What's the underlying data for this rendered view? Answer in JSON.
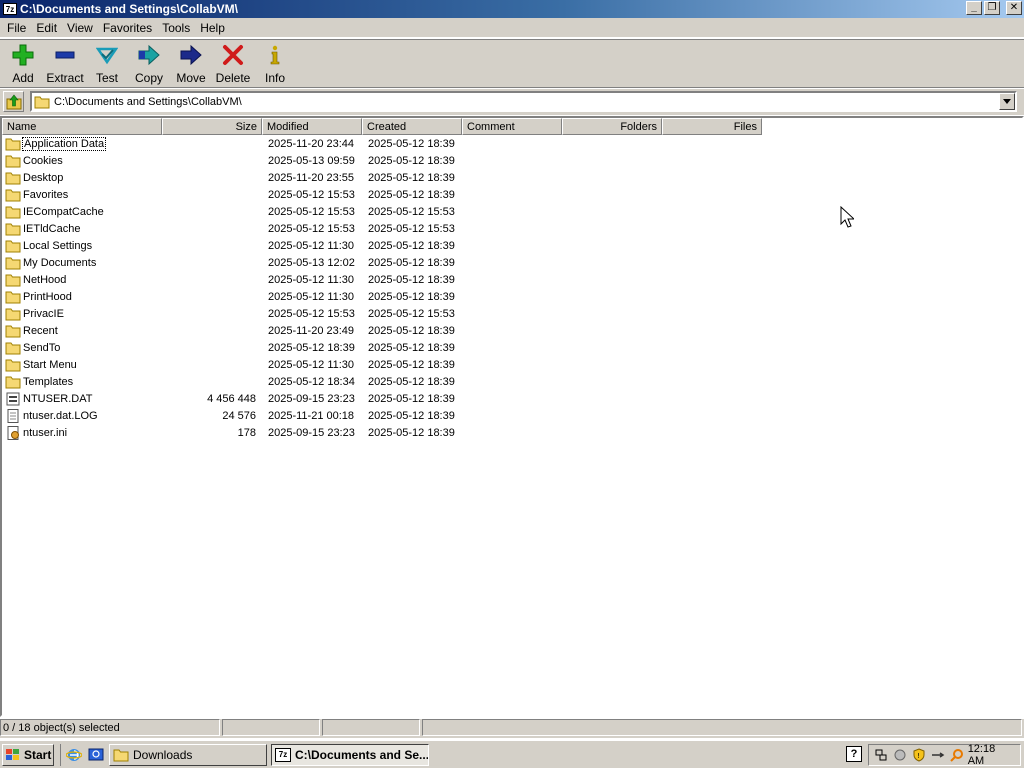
{
  "window": {
    "app_icon": "7z",
    "title": "C:\\Documents and Settings\\CollabVM\\",
    "buttons": {
      "minimize": "_",
      "restore": "❐",
      "close": "✕"
    }
  },
  "menu": [
    "File",
    "Edit",
    "View",
    "Favorites",
    "Tools",
    "Help"
  ],
  "toolbar": [
    {
      "label": "Add",
      "icon": "add-icon",
      "color": "#1a9c1a"
    },
    {
      "label": "Extract",
      "icon": "extract-icon",
      "color": "#1c3aa8"
    },
    {
      "label": "Test",
      "icon": "test-icon",
      "color": "#1a9cb8"
    },
    {
      "label": "Copy",
      "icon": "copy-icon",
      "color": "#19a3a3"
    },
    {
      "label": "Move",
      "icon": "move-icon",
      "color": "#1c2a8a"
    },
    {
      "label": "Delete",
      "icon": "delete-icon",
      "color": "#d01a1a"
    },
    {
      "label": "Info",
      "icon": "info-icon",
      "color": "#c8a800"
    }
  ],
  "address": {
    "path": "C:\\Documents and Settings\\CollabVM\\"
  },
  "columns": [
    {
      "label": "Name"
    },
    {
      "label": "Size"
    },
    {
      "label": "Modified"
    },
    {
      "label": "Created"
    },
    {
      "label": "Comment"
    },
    {
      "label": "Folders"
    },
    {
      "label": "Files"
    }
  ],
  "files": [
    {
      "name": "Application Data",
      "type": "folder",
      "size": "",
      "modified": "2025-11-20 23:44",
      "created": "2025-05-12 18:39",
      "focused": true
    },
    {
      "name": "Cookies",
      "type": "folder",
      "size": "",
      "modified": "2025-05-13 09:59",
      "created": "2025-05-12 18:39"
    },
    {
      "name": "Desktop",
      "type": "folder",
      "size": "",
      "modified": "2025-11-20 23:55",
      "created": "2025-05-12 18:39"
    },
    {
      "name": "Favorites",
      "type": "folder",
      "size": "",
      "modified": "2025-05-12 15:53",
      "created": "2025-05-12 18:39"
    },
    {
      "name": "IECompatCache",
      "type": "folder",
      "size": "",
      "modified": "2025-05-12 15:53",
      "created": "2025-05-12 15:53"
    },
    {
      "name": "IETldCache",
      "type": "folder",
      "size": "",
      "modified": "2025-05-12 15:53",
      "created": "2025-05-12 15:53"
    },
    {
      "name": "Local Settings",
      "type": "folder",
      "size": "",
      "modified": "2025-05-12 11:30",
      "created": "2025-05-12 18:39"
    },
    {
      "name": "My Documents",
      "type": "folder",
      "size": "",
      "modified": "2025-05-13 12:02",
      "created": "2025-05-12 18:39"
    },
    {
      "name": "NetHood",
      "type": "folder",
      "size": "",
      "modified": "2025-05-12 11:30",
      "created": "2025-05-12 18:39"
    },
    {
      "name": "PrintHood",
      "type": "folder",
      "size": "",
      "modified": "2025-05-12 11:30",
      "created": "2025-05-12 18:39"
    },
    {
      "name": "PrivacIE",
      "type": "folder",
      "size": "",
      "modified": "2025-05-12 15:53",
      "created": "2025-05-12 15:53"
    },
    {
      "name": "Recent",
      "type": "folder",
      "size": "",
      "modified": "2025-11-20 23:49",
      "created": "2025-05-12 18:39"
    },
    {
      "name": "SendTo",
      "type": "folder",
      "size": "",
      "modified": "2025-05-12 18:39",
      "created": "2025-05-12 18:39"
    },
    {
      "name": "Start Menu",
      "type": "folder",
      "size": "",
      "modified": "2025-05-12 11:30",
      "created": "2025-05-12 18:39"
    },
    {
      "name": "Templates",
      "type": "folder",
      "size": "",
      "modified": "2025-05-12 18:34",
      "created": "2025-05-12 18:39"
    },
    {
      "name": "NTUSER.DAT",
      "type": "file-dat",
      "size": "4 456 448",
      "modified": "2025-09-15 23:23",
      "created": "2025-05-12 18:39"
    },
    {
      "name": "ntuser.dat.LOG",
      "type": "file-log",
      "size": "24 576",
      "modified": "2025-11-21 00:18",
      "created": "2025-05-12 18:39"
    },
    {
      "name": "ntuser.ini",
      "type": "file-ini",
      "size": "178",
      "modified": "2025-09-15 23:23",
      "created": "2025-05-12 18:39"
    }
  ],
  "status": {
    "selection": "0 / 18 object(s) selected"
  },
  "taskbar": {
    "start_label": "Start",
    "tasks": [
      {
        "label": "Downloads",
        "active": false
      },
      {
        "label": "C:\\Documents and Se...",
        "active": true
      }
    ],
    "clock": "12:18 AM"
  }
}
